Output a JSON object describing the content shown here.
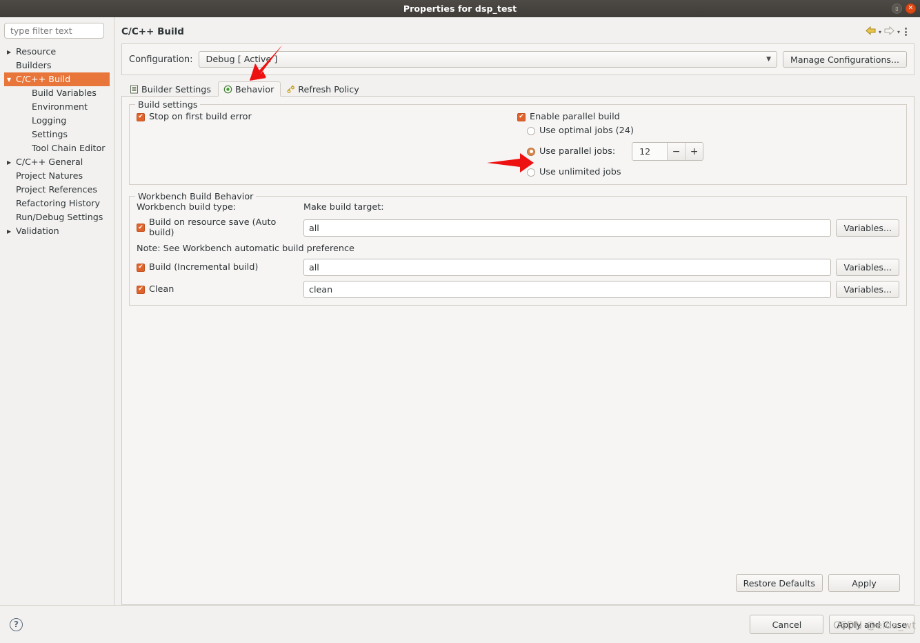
{
  "window": {
    "title": "Properties for dsp_test",
    "maximize_icon": "restore-icon",
    "close_icon": "close-icon"
  },
  "sidebar": {
    "filter_placeholder": "type filter text",
    "filter_value": "",
    "items": [
      {
        "label": "Resource",
        "level": 1,
        "twisty": "▶",
        "selected": false
      },
      {
        "label": "Builders",
        "level": 1,
        "twisty": "",
        "selected": false
      },
      {
        "label": "C/C++ Build",
        "level": 1,
        "twisty": "▼",
        "selected": true
      },
      {
        "label": "Build Variables",
        "level": 2,
        "twisty": "",
        "selected": false
      },
      {
        "label": "Environment",
        "level": 2,
        "twisty": "",
        "selected": false
      },
      {
        "label": "Logging",
        "level": 2,
        "twisty": "",
        "selected": false
      },
      {
        "label": "Settings",
        "level": 2,
        "twisty": "",
        "selected": false
      },
      {
        "label": "Tool Chain Editor",
        "level": 2,
        "twisty": "",
        "selected": false
      },
      {
        "label": "C/C++ General",
        "level": 1,
        "twisty": "▶",
        "selected": false
      },
      {
        "label": "Project Natures",
        "level": 1,
        "twisty": "",
        "selected": false
      },
      {
        "label": "Project References",
        "level": 1,
        "twisty": "",
        "selected": false
      },
      {
        "label": "Refactoring History",
        "level": 1,
        "twisty": "",
        "selected": false
      },
      {
        "label": "Run/Debug Settings",
        "level": 1,
        "twisty": "",
        "selected": false
      },
      {
        "label": "Validation",
        "level": 1,
        "twisty": "▶",
        "selected": false
      }
    ]
  },
  "header": {
    "title": "C/C++ Build",
    "back_icon": "back-arrow-icon",
    "back_caret": "▾",
    "forward_icon": "forward-arrow-icon",
    "forward_caret": "▾",
    "menu_icon": "view-menu-icon"
  },
  "configuration": {
    "label": "Configuration:",
    "value": "Debug  [ Active ]",
    "caret": "▼",
    "manage_button": "Manage Configurations..."
  },
  "tabs": [
    {
      "label": "Builder Settings",
      "icon": "builder-settings-icon",
      "active": false
    },
    {
      "label": "Behavior",
      "icon": "behavior-icon",
      "active": true
    },
    {
      "label": "Refresh Policy",
      "icon": "refresh-policy-icon",
      "active": false
    }
  ],
  "build_settings": {
    "group_title": "Build settings",
    "stop_on_first_error": {
      "label": "Stop on first build error",
      "checked": true
    },
    "enable_parallel_build": {
      "label": "Enable parallel build",
      "checked": true
    },
    "options": [
      {
        "label": "Use optimal jobs (24)",
        "selected": false
      },
      {
        "label": "Use parallel jobs:",
        "selected": true
      },
      {
        "label": "Use unlimited jobs",
        "selected": false
      }
    ],
    "jobs_value": "12",
    "spin_down": "−",
    "spin_up": "+"
  },
  "workbench": {
    "group_title": "Workbench Build Behavior",
    "col1_header": "Workbench build type:",
    "col2_header": "Make build target:",
    "note": "Note: See Workbench automatic build preference",
    "rows": [
      {
        "label": "Build on resource save (Auto build)",
        "checked": true,
        "target": "all",
        "button": "Variables..."
      },
      {
        "label": "Build (Incremental build)",
        "checked": true,
        "target": "all",
        "button": "Variables..."
      },
      {
        "label": "Clean",
        "checked": true,
        "target": "clean",
        "button": "Variables..."
      }
    ]
  },
  "panel_buttons": {
    "restore_defaults": "Restore Defaults",
    "apply": "Apply"
  },
  "dialog_buttons": {
    "help_icon": "help-icon",
    "cancel": "Cancel",
    "apply_and_close": "Apply and Close"
  },
  "annotations": {
    "arrow_configuration": "red-arrow-pointing-to-configuration",
    "arrow_parallel_jobs": "red-arrow-pointing-to-use-parallel-jobs"
  },
  "watermark": {
    "text": "CSDN @eida_wt"
  },
  "colors": {
    "accent": "#e8763a",
    "checkbox": "#e0632c",
    "titlebar": "#403d39",
    "close": "#dd4814",
    "annotation": "#ee1111"
  }
}
